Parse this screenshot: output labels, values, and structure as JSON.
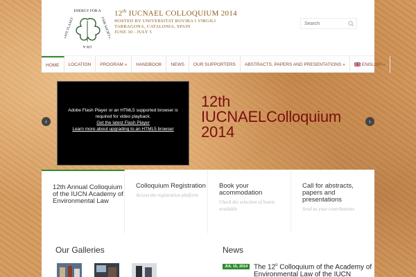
{
  "logo": {
    "ring_text": "ENERGY FOR A FAIR SOCIETY ON A SAFE PLANET",
    "ring_top": "ENERGY FOR A",
    "ring_right": "FAIR SOCIETY",
    "ring_bottom": "ON A",
    "ring_left": "SAFE PLANET"
  },
  "conference": {
    "number": "12",
    "number_suffix": "th",
    "title": "IUCNAEL COLLOQUIUM 2014",
    "line1": "HOSTED BY UNIVERSITAT ROVIRA I VIRGILI",
    "line2": "TARRAGONA, CATALONIA, SPAIN",
    "line3": "JUNE 30 - JULY 5"
  },
  "search": {
    "placeholder": "Search"
  },
  "nav": {
    "items": [
      {
        "label": "HOME"
      },
      {
        "label": "LOCATION"
      },
      {
        "label": "PROGRAM »"
      },
      {
        "label": "HANDBOOK"
      },
      {
        "label": "NEWS"
      },
      {
        "label": "OUR SUPPORTERS"
      },
      {
        "label": "ABSTRACTS, PAPERS AND PRESENTATIONS »"
      },
      {
        "label": "ENGLISH »"
      }
    ]
  },
  "slider": {
    "video_msg_line1": "Adobe Flash Player or an HTML5 supported browser is",
    "video_msg_line2": "required for video playback.",
    "video_link1": "Get the latest Flash Player",
    "video_link2": "Learn more about upgrading to an HTML5 browser",
    "title_line1": "12th",
    "title_line2": "IUCNAELColloquium",
    "title_line3": "2014",
    "prev_glyph": "‹",
    "next_glyph": "›"
  },
  "features": [
    {
      "title": "12th Annual Colloquium of the IUCN Academy of Environmental Law",
      "subtitle": ""
    },
    {
      "title": "Colloquium Registration",
      "subtitle": "Access the registration platform"
    },
    {
      "title": "Book your acommodation",
      "subtitle": "Check the selection of hotels available"
    },
    {
      "title": "Call for abstracts, papers and presentations",
      "subtitle": "Send us your contributions"
    }
  ],
  "galleries": {
    "title": "Our Galleries"
  },
  "news": {
    "title": "News",
    "date": "JUL 15, 2014",
    "headline_pre": "The 12",
    "headline_sup": "o",
    "headline_post": " Colloquium of the Academy of Environmental Law of the IUCN"
  },
  "colors": {
    "nav_text": "#8c4a33",
    "accent_green": "#2f8a2f",
    "slide_title": "#7a0f0f",
    "conf_title": "#8a5a1a"
  }
}
